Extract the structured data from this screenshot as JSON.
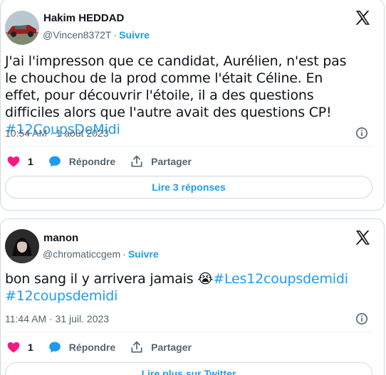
{
  "tweets": [
    {
      "author_name": "Hakim HEDDAD",
      "handle": "@Vincen8372T",
      "separator": "·",
      "follow_label": "Suivre",
      "text_parts": [
        {
          "type": "text",
          "value": "J'ai l'impresson que ce candidat, Aurélien, n'est pas le chouchou de la prod comme l'était Céline. En effet, pour découvrir l'étoile, il a des questions difficiles alors que l'autre avait des questions CP! "
        },
        {
          "type": "hashtag",
          "value": "#12CoupsDeMidi"
        }
      ],
      "timestamp": "10:54 AM · 1 août 2023",
      "like_count": "1",
      "reply_label": "Répondre",
      "share_label": "Partager",
      "pill_label": "Lire 3 réponses"
    },
    {
      "author_name": "manon",
      "handle": "@chromaticcgem",
      "separator": "·",
      "follow_label": "Suivre",
      "text_parts": [
        {
          "type": "text",
          "value": "bon sang il y arrivera jamais "
        },
        {
          "type": "emoji",
          "value": "😭"
        },
        {
          "type": "hashtag",
          "value": "#Les12coupsdemidi"
        },
        {
          "type": "text",
          "value": " "
        },
        {
          "type": "hashtag",
          "value": "#12coupsdemidi"
        }
      ],
      "timestamp": "11:44 AM · 31 juil. 2023",
      "like_count": "1",
      "reply_label": "Répondre",
      "share_label": "Partager",
      "pill_label": "Lire plus sur Twitter"
    }
  ],
  "icons": {
    "logo": "x-logo-icon",
    "info": "info-icon",
    "like": "heart-icon",
    "reply": "speech-bubble-icon",
    "share": "share-icon"
  },
  "colors": {
    "accent": "#1d9bf0",
    "like": "#f91880",
    "secondary_text": "#536471",
    "border": "#cfd9de"
  }
}
